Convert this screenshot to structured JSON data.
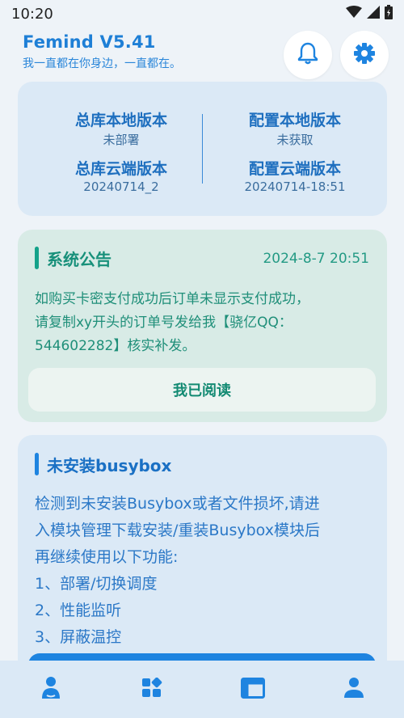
{
  "status_bar": {
    "time": "10:20",
    "icons": [
      "wifi-icon",
      "cell-signal-icon",
      "battery-icon"
    ]
  },
  "header": {
    "title": "Femind V5.41",
    "subtitle": "我一直都在你身边，一直都在。",
    "buttons": [
      "bell-icon",
      "gear-icon"
    ]
  },
  "versions": {
    "main_local_label": "总库本地版本",
    "main_local_value": "未部署",
    "main_cloud_label": "总库云端版本",
    "main_cloud_value": "20240714_2",
    "config_local_label": "配置本地版本",
    "config_local_value": "未获取",
    "config_cloud_label": "配置云端版本",
    "config_cloud_value": "20240714-18:51"
  },
  "notice": {
    "title": "系统公告",
    "date": "2024-8-7 20:51",
    "lines": [
      "如购买卡密支付成功后订单未显示支付成功，",
      "请复制xy开头的订单号发给我【骁亿QQ：",
      "544602282】核实补发。"
    ],
    "read_button": "我已阅读"
  },
  "busybox": {
    "title": "未安装busybox",
    "lines": [
      "检测到未安装Busybox或者文件损坏,请进",
      "入模块管理下载安装/重装Busybox模块后",
      "再继续使用以下功能:",
      "1、部署/切换调度",
      "2、性能监听",
      "3、屏蔽温控"
    ]
  },
  "bottom_nav": {
    "items": [
      "person-home-icon",
      "modules-grid-icon",
      "layout-panel-icon",
      "user-profile-icon"
    ]
  },
  "colors": {
    "accent_blue": "#1e84e0",
    "accent_teal": "#14a28a",
    "card_blue": "#dbe9f6",
    "card_teal": "#d8ebe6",
    "background": "#eef3f8"
  }
}
